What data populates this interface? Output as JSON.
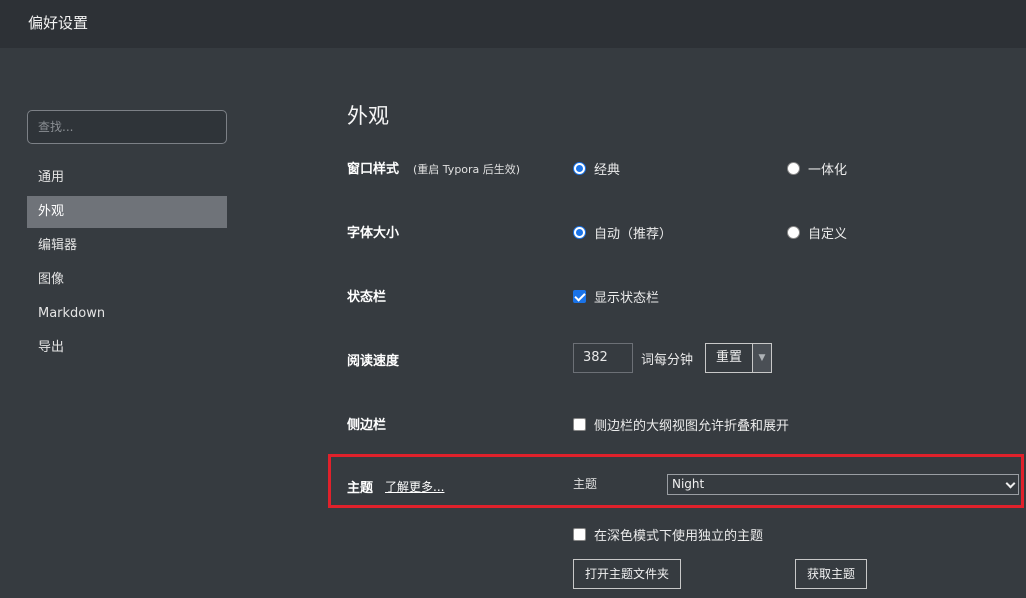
{
  "window": {
    "title": "偏好设置"
  },
  "search": {
    "placeholder": "查找..."
  },
  "sidebar": {
    "items": [
      {
        "label": "通用"
      },
      {
        "label": "外观"
      },
      {
        "label": "编辑器"
      },
      {
        "label": "图像"
      },
      {
        "label": "Markdown"
      },
      {
        "label": "导出"
      }
    ],
    "active": "外观"
  },
  "main": {
    "title": "外观",
    "window_style": {
      "label": "窗口样式",
      "note": "(重启 Typora 后生效)",
      "options": [
        "经典",
        "一体化"
      ],
      "selected": "经典"
    },
    "font_size": {
      "label": "字体大小",
      "options": [
        "自动（推荐）",
        "自定义"
      ],
      "selected": "自动（推荐）"
    },
    "status_bar": {
      "label": "状态栏",
      "checkbox": "显示状态栏",
      "checked": true
    },
    "reading_speed": {
      "label": "阅读速度",
      "value": "382",
      "unit": "词每分钟",
      "reset": "重置",
      "caret": "▼"
    },
    "sidebar_setting": {
      "label": "侧边栏",
      "checkbox": "侧边栏的大纲视图允许折叠和展开",
      "checked": false
    },
    "theme": {
      "label": "主题",
      "learn_more": "了解更多...",
      "sublabel": "主题",
      "selected": "Night"
    },
    "dark_theme": {
      "checkbox": "在深色模式下使用独立的主题",
      "checked": false
    },
    "buttons": {
      "open_folder": "打开主题文件夹",
      "get_themes": "获取主题"
    }
  },
  "colors": {
    "background": "#363b40",
    "titlebar": "#2d3136",
    "active_item": "#6f7379",
    "accent": "#1a73e8",
    "highlight": "#e0212b"
  }
}
